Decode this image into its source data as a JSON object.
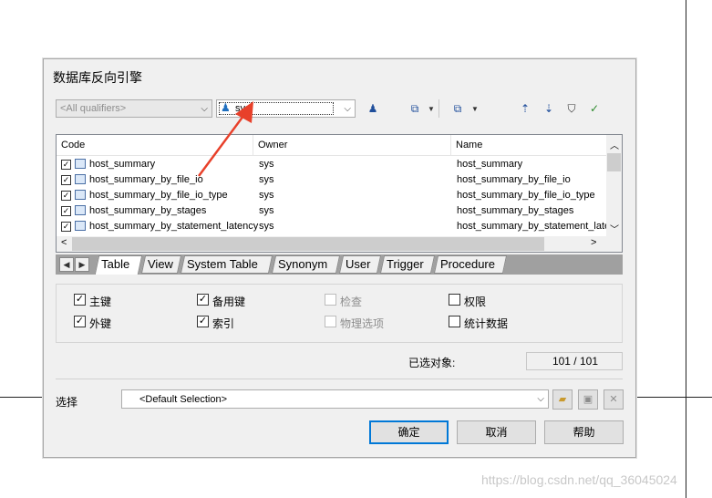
{
  "dialog": {
    "title": "数据库反向引擎",
    "qualifier_combo": {
      "value": "<All qualifiers>"
    },
    "owner_combo": {
      "value": "sys"
    }
  },
  "grid": {
    "columns": [
      "Code",
      "Owner",
      "Name"
    ],
    "rows": [
      {
        "checked": true,
        "code": "host_summary",
        "owner": "sys",
        "name": "host_summary"
      },
      {
        "checked": true,
        "code": "host_summary_by_file_io",
        "owner": "sys",
        "name": "host_summary_by_file_io"
      },
      {
        "checked": true,
        "code": "host_summary_by_file_io_type",
        "owner": "sys",
        "name": "host_summary_by_file_io_type"
      },
      {
        "checked": true,
        "code": "host_summary_by_stages",
        "owner": "sys",
        "name": "host_summary_by_stages"
      },
      {
        "checked": true,
        "code": "host_summary_by_statement_latency",
        "owner": "sys",
        "name": "host_summary_by_statement_later"
      }
    ]
  },
  "tabs": [
    "Table",
    "View",
    "System Table",
    "Synonym",
    "User",
    "Trigger",
    "Procedure"
  ],
  "options": {
    "primary_key": {
      "label": "主键",
      "checked": true
    },
    "alternate_key": {
      "label": "备用键",
      "checked": true
    },
    "check": {
      "label": "检查",
      "checked": false
    },
    "permissions": {
      "label": "权限",
      "checked": false
    },
    "foreign_key": {
      "label": "外键",
      "checked": true
    },
    "index": {
      "label": "索引",
      "checked": true
    },
    "physical_options": {
      "label": "物理选项",
      "checked": false
    },
    "statistics": {
      "label": "统计数据",
      "checked": false
    }
  },
  "selected": {
    "label": "已选对象:",
    "value": "101 / 101"
  },
  "selection": {
    "label": "选择",
    "value": "<Default Selection>"
  },
  "buttons": {
    "ok": "确定",
    "cancel": "取消",
    "help": "帮助"
  },
  "watermark": "https://blog.csdn.net/qq_36045024",
  "colors": {
    "accent": "#0078d7",
    "arrow": "#e8402a"
  }
}
